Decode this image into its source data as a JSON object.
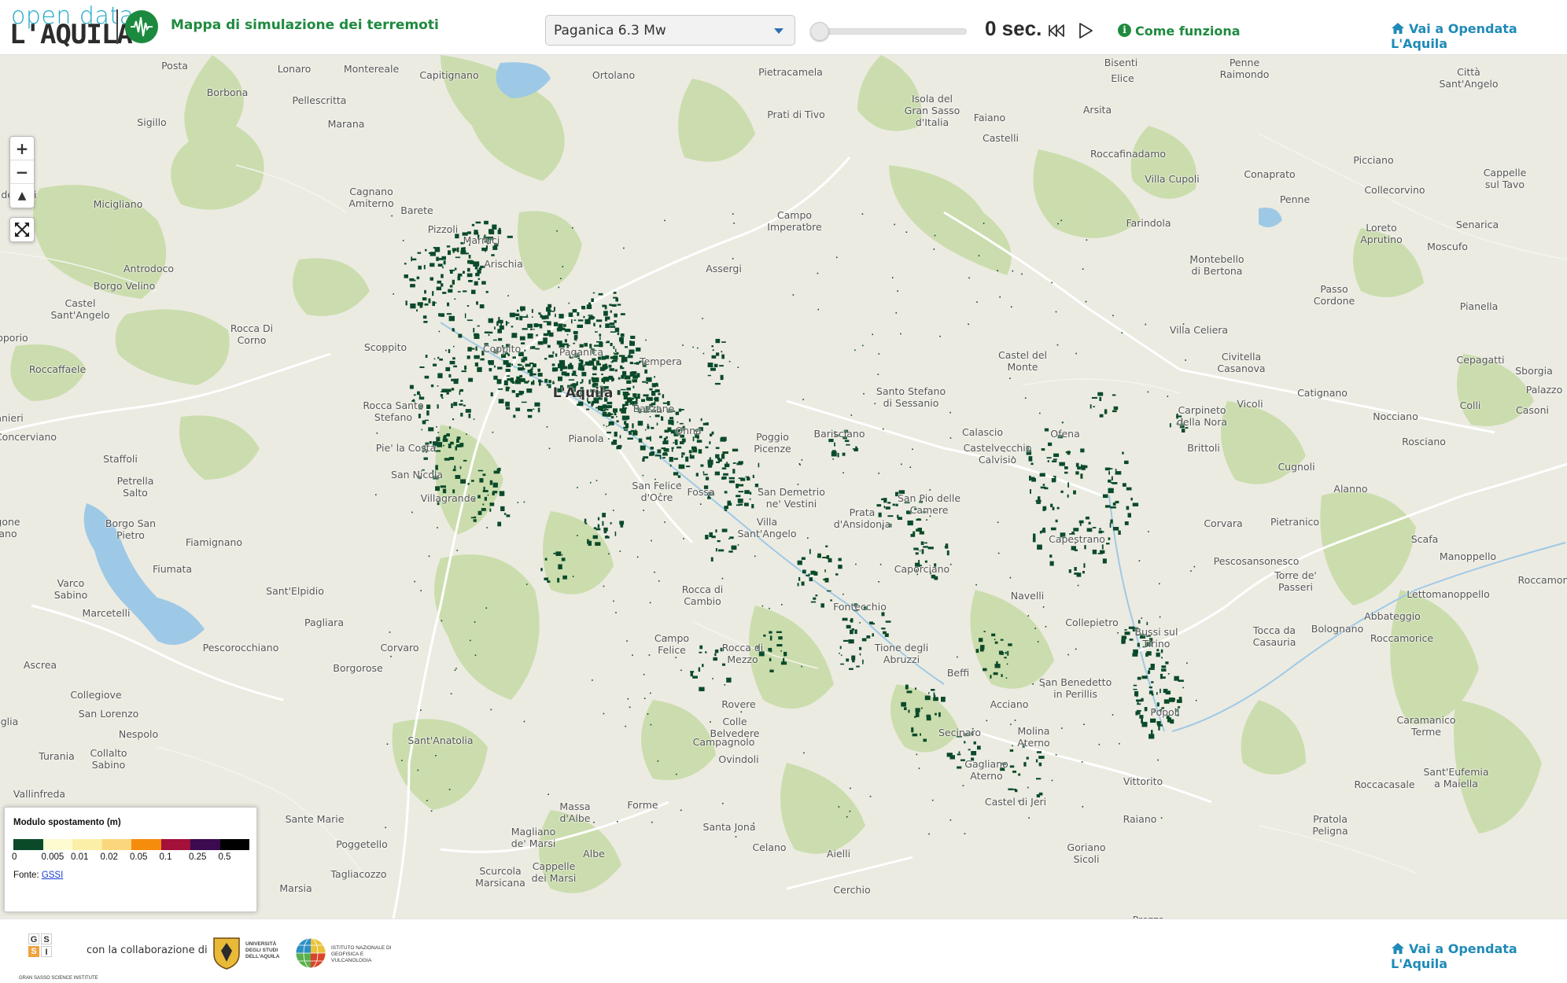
{
  "header": {
    "logo_line1": "open data",
    "logo_line2": "L'AQUILA",
    "app_title": "Mappa di simulazione dei terremoti",
    "scenario_select": {
      "selected": "Paganica 6.3 Mw"
    },
    "time_readout": "0 sec.",
    "how_it_works": "Come funziona",
    "opendata_link": "Vai a Opendata L'Aquila"
  },
  "map": {
    "zoom_in": "+",
    "zoom_out": "−",
    "reset_north": "▲",
    "places": [
      {
        "id": "posta",
        "name": "Posta"
      },
      {
        "id": "lonaro",
        "name": "Lonaro"
      },
      {
        "id": "montereale",
        "name": "Montereale"
      },
      {
        "id": "capitignano",
        "name": "Capitignano"
      },
      {
        "id": "ortolano",
        "name": "Ortolano"
      },
      {
        "id": "pietracamela",
        "name": "Pietracamela"
      },
      {
        "id": "bisenti",
        "name": "Bisenti"
      },
      {
        "id": "nereto",
        "name": "Penne\nRaimondo"
      },
      {
        "id": "elice",
        "name": "Elice"
      },
      {
        "id": "santangelo",
        "name": "Città\nSant'Angelo"
      },
      {
        "id": "borbona",
        "name": "Borbona"
      },
      {
        "id": "pellescritta",
        "name": "Pellescritta"
      },
      {
        "id": "granaggio",
        "name": "Isola del\nGran Sasso\nd'Italia"
      },
      {
        "id": "pratidtivo",
        "name": "Prati di Tivo"
      },
      {
        "id": "faiano",
        "name": "Faiano"
      },
      {
        "id": "arsita",
        "name": "Arsita"
      },
      {
        "id": "sigillo",
        "name": "Sigillo"
      },
      {
        "id": "marana",
        "name": "Marana"
      },
      {
        "id": "castelli",
        "name": "Castelli"
      },
      {
        "id": "roccafinadamo",
        "name": "Roccafinadamo"
      },
      {
        "id": "picciano",
        "name": "Picciano"
      },
      {
        "id": "cappelle",
        "name": "Cappelle\nsul Tavo"
      },
      {
        "id": "villacupoli",
        "name": "Villa Cupoli"
      },
      {
        "id": "conaprato",
        "name": "Conaprato"
      },
      {
        "id": "collecorvino",
        "name": "Collecorvino"
      },
      {
        "id": "cagnano",
        "name": "Cagnano\nAmiterno"
      },
      {
        "id": "micigliano",
        "name": "Micigliano"
      },
      {
        "id": "devalli",
        "name": "n de Valli"
      },
      {
        "id": "campoimp",
        "name": "Campo\nImperatore"
      },
      {
        "id": "farindola",
        "name": "Farindola"
      },
      {
        "id": "penne",
        "name": "Penne"
      },
      {
        "id": "loreto",
        "name": "Loreto\nAprutino"
      },
      {
        "id": "senarica",
        "name": "Senarica"
      },
      {
        "id": "moscufo",
        "name": "Moscufo"
      },
      {
        "id": "barete",
        "name": "Barete"
      },
      {
        "id": "pizzoli",
        "name": "Pizzoli"
      },
      {
        "id": "marruci",
        "name": "Marruci"
      },
      {
        "id": "arischia",
        "name": "Arischia"
      },
      {
        "id": "assergi",
        "name": "Assergi"
      },
      {
        "id": "antrodoco",
        "name": "Antrodoco"
      },
      {
        "id": "borgovelino",
        "name": "Borgo Velino"
      },
      {
        "id": "montebello",
        "name": "Montebello\ndi Bertona"
      },
      {
        "id": "passocordone",
        "name": "Passo\nCordone"
      },
      {
        "id": "castelsa",
        "name": "Castel\nSant'Angelo"
      },
      {
        "id": "roccadicorno",
        "name": "Rocca Di\nCorno"
      },
      {
        "id": "pianella",
        "name": "Pianella"
      },
      {
        "id": "villaceliera",
        "name": "Villa Celiera"
      },
      {
        "id": "poporio",
        "name": "poporio"
      },
      {
        "id": "scoppito",
        "name": "Scoppito"
      },
      {
        "id": "coppito",
        "name": "Coppito"
      },
      {
        "id": "paganica",
        "name": "Paganica"
      },
      {
        "id": "tempera",
        "name": "Tempera"
      },
      {
        "id": "castelmonte",
        "name": "Castel del\nMonte"
      },
      {
        "id": "civitella",
        "name": "Civitella\nCasanova"
      },
      {
        "id": "cepagatti",
        "name": "Cepagatti"
      },
      {
        "id": "sborgia",
        "name": "Sborgia"
      },
      {
        "id": "palazzo",
        "name": "Palazzo"
      },
      {
        "id": "laquila",
        "name": "L'Aquila"
      },
      {
        "id": "roccaffaele",
        "name": "Roccaffaele"
      },
      {
        "id": "santostefano",
        "name": "Santo Stefano\ndi Sessanio"
      },
      {
        "id": "vicoli",
        "name": "Vicoli"
      },
      {
        "id": "catignano",
        "name": "Catignano"
      },
      {
        "id": "colli",
        "name": "Colli"
      },
      {
        "id": "casoni",
        "name": "Casoni"
      },
      {
        "id": "roccasantostef",
        "name": "Rocca Santo\nStefano"
      },
      {
        "id": "bazzano",
        "name": "Bazzano"
      },
      {
        "id": "carpineto",
        "name": "Carpineto\ndella Nora"
      },
      {
        "id": "nocciano",
        "name": "Nocciano"
      },
      {
        "id": "anieri",
        "name": "anieri"
      },
      {
        "id": "onna",
        "name": "Onna"
      },
      {
        "id": "barisciano",
        "name": "Barisciano"
      },
      {
        "id": "calascio",
        "name": "Calascio"
      },
      {
        "id": "ofena",
        "name": "Ofena"
      },
      {
        "id": "rosciano",
        "name": "Rosciano"
      },
      {
        "id": "conceviano",
        "name": "Concerviano"
      },
      {
        "id": "pianola",
        "name": "Pianola"
      },
      {
        "id": "poggiopicenze",
        "name": "Poggio\nPicenze"
      },
      {
        "id": "brittoli",
        "name": "Brittoli"
      },
      {
        "id": "pielacosta",
        "name": "Pie' la Costa"
      },
      {
        "id": "castelvecchio",
        "name": "Castelvecchio\nCalvisio"
      },
      {
        "id": "staffoli",
        "name": "Staffoli"
      },
      {
        "id": "cugnoli",
        "name": "Cugnoli"
      },
      {
        "id": "sannicola",
        "name": "San Nicola"
      },
      {
        "id": "petrella",
        "name": "Petrella\nSalto"
      },
      {
        "id": "sanfelice",
        "name": "San Felice\nd'Ocre"
      },
      {
        "id": "fossa",
        "name": "Fossa"
      },
      {
        "id": "sandemetrio",
        "name": "San Demetrio\nne' Vestini"
      },
      {
        "id": "alanno",
        "name": "Alanno"
      },
      {
        "id": "villagrande",
        "name": "Villagrande"
      },
      {
        "id": "sanpio",
        "name": "San Pio delle\nCamere"
      },
      {
        "id": "prata",
        "name": "Prata\nd'Ansidonia"
      },
      {
        "id": "gone",
        "name": "gone\nano"
      },
      {
        "id": "borgosanpietro",
        "name": "Borgo San\nPietro"
      },
      {
        "id": "villasa",
        "name": "Villa\nSant'Angelo"
      },
      {
        "id": "capestrano",
        "name": "Capestrano"
      },
      {
        "id": "corvara",
        "name": "Corvara"
      },
      {
        "id": "pietranico",
        "name": "Pietranico"
      },
      {
        "id": "scafa",
        "name": "Scafa"
      },
      {
        "id": "fiamignano",
        "name": "Fiamignano"
      },
      {
        "id": "pescosansonesco",
        "name": "Pescosansonesco"
      },
      {
        "id": "manoppello",
        "name": "Manoppello"
      },
      {
        "id": "fiumata",
        "name": "Fiumata"
      },
      {
        "id": "caporciano",
        "name": "Caporciano"
      },
      {
        "id": "torredepasseri",
        "name": "Torre de'\nPasseri"
      },
      {
        "id": "roccamon",
        "name": "Roccamon"
      },
      {
        "id": "varco",
        "name": "Varco\nSabino"
      },
      {
        "id": "santelpidio",
        "name": "Sant'Elpidio"
      },
      {
        "id": "roccadicambio",
        "name": "Rocca di\nCambio"
      },
      {
        "id": "navelli",
        "name": "Navelli"
      },
      {
        "id": "lettomanoppello",
        "name": "Lettomanoppello"
      },
      {
        "id": "marcetelli",
        "name": "Marcetelli"
      },
      {
        "id": "fontecchio",
        "name": "Fontecchio"
      },
      {
        "id": "collepietro",
        "name": "Collepietro"
      },
      {
        "id": "abbateggio",
        "name": "Abbateggio"
      },
      {
        "id": "pagliara",
        "name": "Pagliara"
      },
      {
        "id": "campofelice",
        "name": "Campo\nFelice"
      },
      {
        "id": "roccadimezzo",
        "name": "Rocca di\nMezzo"
      },
      {
        "id": "tione",
        "name": "Tione degli\nAbruzzi"
      },
      {
        "id": "bussi",
        "name": "Bussi sul\nTirino"
      },
      {
        "id": "toccadacasauria",
        "name": "Tocca da\nCasauria"
      },
      {
        "id": "bolognano",
        "name": "Bolognano"
      },
      {
        "id": "roccamorice",
        "name": "Roccamorice"
      },
      {
        "id": "pescorocchiano",
        "name": "Pescorocchiano"
      },
      {
        "id": "corvaro",
        "name": "Corvaro"
      },
      {
        "id": "ascrea",
        "name": "Ascrea"
      },
      {
        "id": "borgorose",
        "name": "Borgorose"
      },
      {
        "id": "beffi",
        "name": "Beffi"
      },
      {
        "id": "sanbenedetto",
        "name": "San Benedetto\nin Perillis"
      },
      {
        "id": "collegiove",
        "name": "Collegiove"
      },
      {
        "id": "rovere",
        "name": "Rovere"
      },
      {
        "id": "acciano",
        "name": "Acciano"
      },
      {
        "id": "popoli",
        "name": "Popoli"
      },
      {
        "id": "sanlorenzo",
        "name": "San Lorenzo"
      },
      {
        "id": "collebelvedere",
        "name": "Colle\nBelvedere"
      },
      {
        "id": "caramanico",
        "name": "Caramanico\nTerme"
      },
      {
        "id": "nespolo",
        "name": "Nespolo"
      },
      {
        "id": "secinaro",
        "name": "Secinaro"
      },
      {
        "id": "molina",
        "name": "Molina\nAterno"
      },
      {
        "id": "lglia",
        "name": "glia"
      },
      {
        "id": "campagnolo",
        "name": "Campagnolo"
      },
      {
        "id": "santanatolia",
        "name": "Sant'Anatolia"
      },
      {
        "id": "turania",
        "name": "Turania"
      },
      {
        "id": "collalto",
        "name": "Collalto\nSabino"
      },
      {
        "id": "ovindoli",
        "name": "Ovindoli"
      },
      {
        "id": "gagliano",
        "name": "Gagliano\nAterno"
      },
      {
        "id": "vittorito",
        "name": "Vittorito"
      },
      {
        "id": "roccacasale",
        "name": "Roccacasale"
      },
      {
        "id": "santeufemia",
        "name": "Sant'Eufemia\na Maiella"
      },
      {
        "id": "vallinfreda",
        "name": "Vallinfreda"
      },
      {
        "id": "casteldiieri",
        "name": "Castel di Ieri"
      },
      {
        "id": "forme",
        "name": "Forme"
      },
      {
        "id": "massadalbe",
        "name": "Massa\nd'Albe"
      },
      {
        "id": "santemarie",
        "name": "Sante Marie"
      },
      {
        "id": "raiano",
        "name": "Raiano"
      },
      {
        "id": "prettoro",
        "name": "Pratola\nPeligna"
      },
      {
        "id": "santajona",
        "name": "Santa Jona"
      },
      {
        "id": "magliano",
        "name": "Magliano\nde' Marsi"
      },
      {
        "id": "poggetello",
        "name": "Poggetello"
      },
      {
        "id": "celano",
        "name": "Celano"
      },
      {
        "id": "goriano",
        "name": "Goriano\nSicoli"
      },
      {
        "id": "albe",
        "name": "Albe"
      },
      {
        "id": "aielli",
        "name": "Aielli"
      },
      {
        "id": "tagliacozzo",
        "name": "Tagliacozzo"
      },
      {
        "id": "cappellemarsi",
        "name": "Cappelle\ndei Marsi"
      },
      {
        "id": "scurcola",
        "name": "Scurcola\nMarsicana"
      },
      {
        "id": "marsia",
        "name": "Marsia"
      },
      {
        "id": "cerchio",
        "name": "Cerchio"
      },
      {
        "id": "prezza",
        "name": "Prezza"
      }
    ]
  },
  "legend": {
    "title": "Modulo spostamento (m)",
    "colors": [
      "#0a4a2a",
      "#fdfbd0",
      "#fbeea6",
      "#fbd67c",
      "#f58c0c",
      "#a3103a",
      "#3b0a4f",
      "#000000"
    ],
    "ticks": [
      "0",
      "0.005",
      "0.01",
      "0.02",
      "0.05",
      "0.1",
      "0.25",
      "0.5"
    ],
    "source_label": "Fonte:",
    "source_link": "GSSI"
  },
  "footer": {
    "gssi_letters": [
      "G",
      "S",
      "S",
      "I"
    ],
    "gssi_caption": "GRAN SASSO SCIENCE INSTITUTE",
    "collab_text": "con la collaborazione di",
    "univ_text": "UNIVERSITÀ DEGLI STUDI DELL'AQUILA",
    "ingv_text": "ISTITUTO NAZIONALE DI GEOFISICA E VULCANOLOGIA",
    "opendata_link": "Vai a Opendata L'Aquila"
  },
  "colors": {
    "brand_green": "#1f8a3f",
    "link_blue": "#1f8ab8",
    "logo_blue": "#25a8c8",
    "map_bg": "#ecebe2",
    "forest": "#c5dba5",
    "water": "#9ec9e6",
    "damage": "#0a4a2a"
  }
}
